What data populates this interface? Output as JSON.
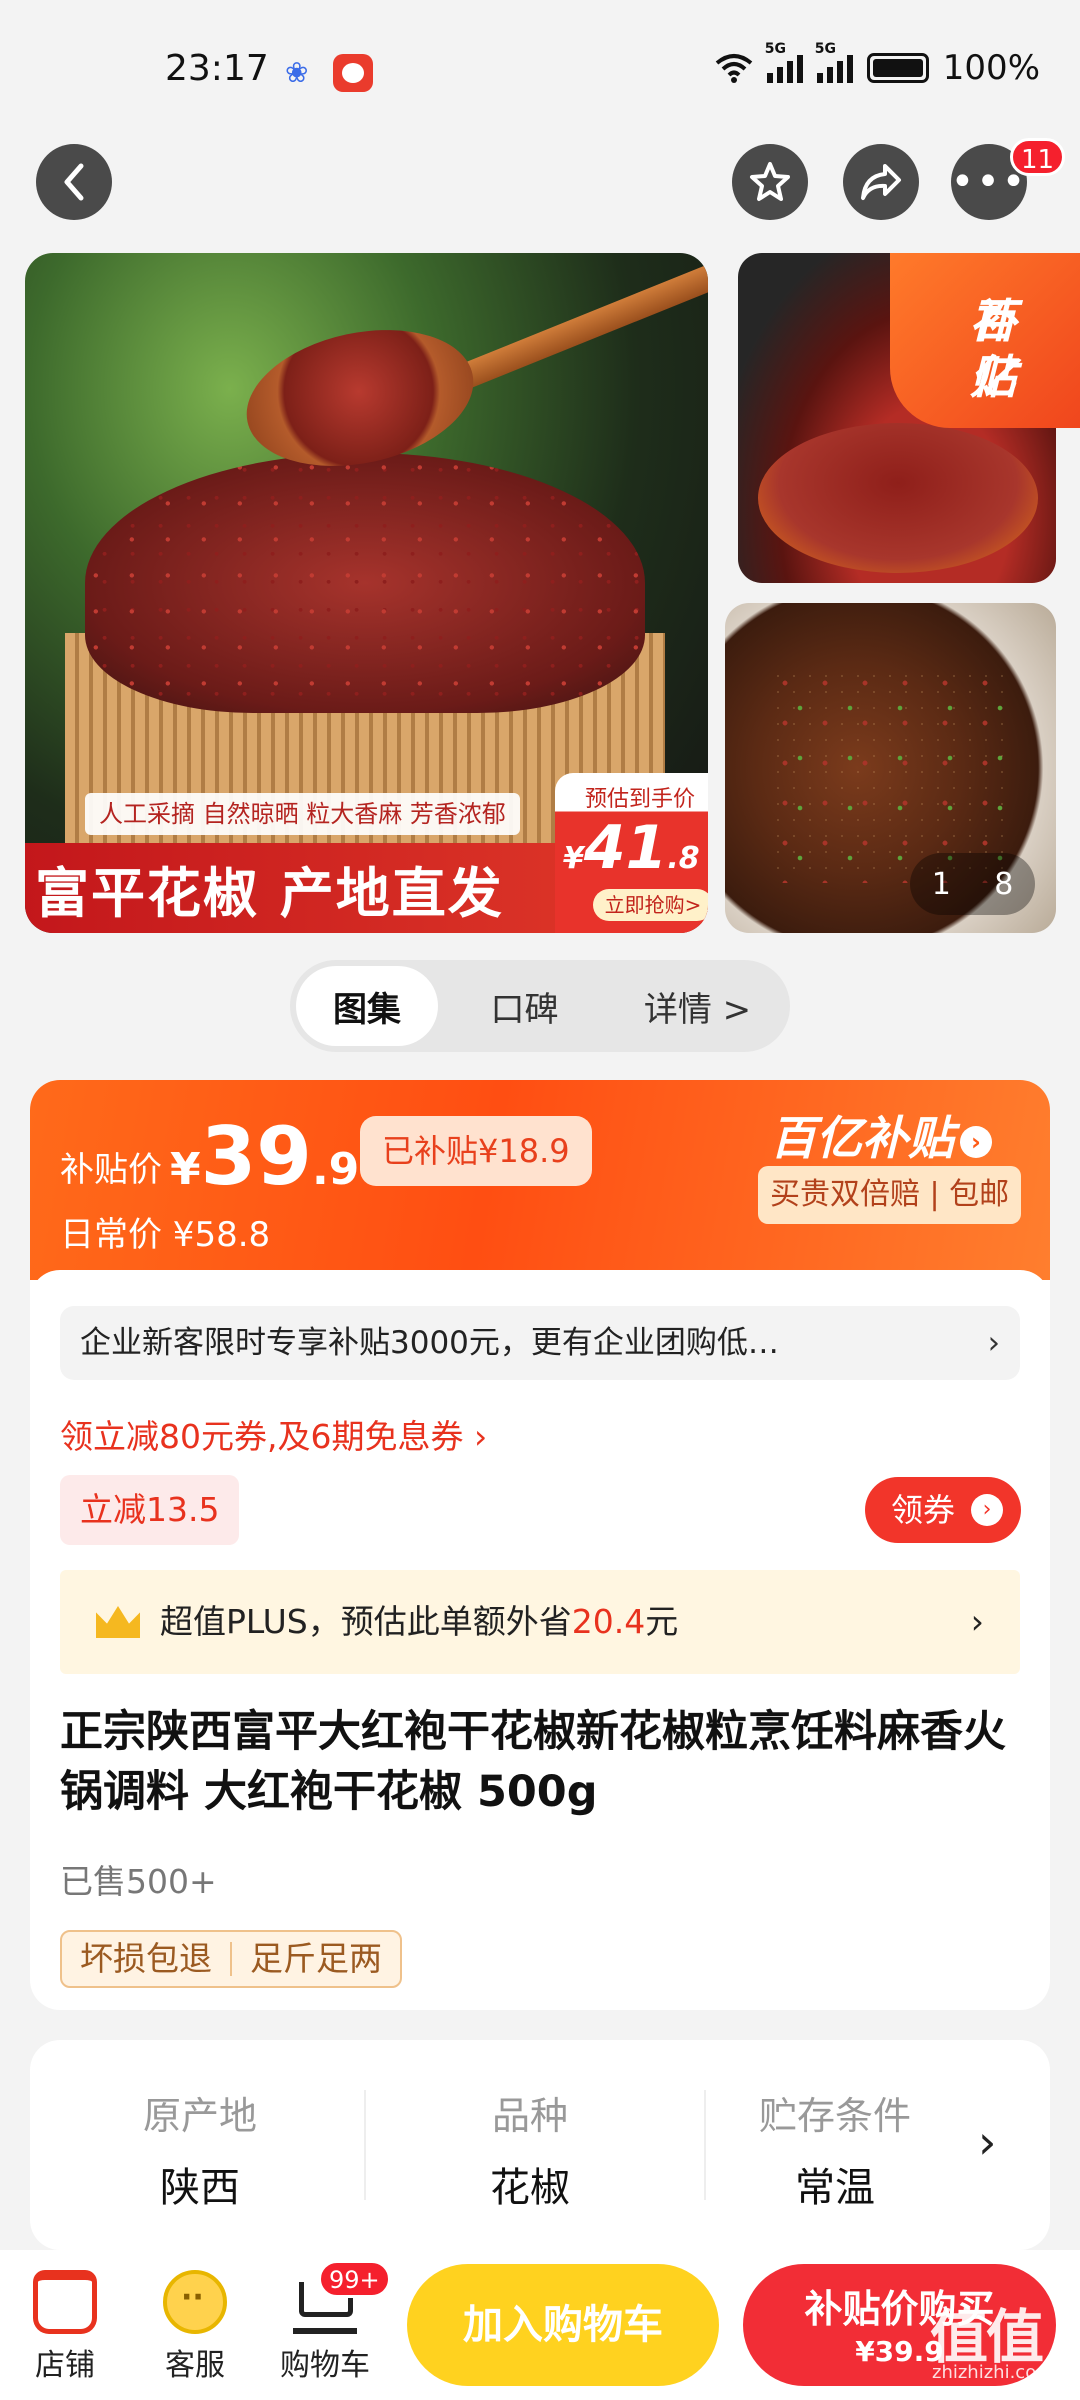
{
  "status_bar": {
    "time": "23:17",
    "battery": "100%",
    "signal1": "5G",
    "signal2": "5G"
  },
  "header": {
    "more_badge": "11"
  },
  "gallery": {
    "main_tagline": "人工采摘 自然晾晒 粒大香麻 芳香浓郁",
    "main_title": "富平花椒 产地直发",
    "sticker_label": "预估到手价",
    "sticker_currency": "¥",
    "sticker_price_int": "41",
    "sticker_price_dec": ".8",
    "sticker_button": "立即抢购>",
    "subsidy_badge_line1": "百亿",
    "subsidy_badge_line2": "补贴",
    "counter_current": "1",
    "counter_total": "8"
  },
  "segment": {
    "tabs": [
      "图集",
      "口碑",
      "详情 >"
    ],
    "active": "图集"
  },
  "price": {
    "label": "补贴价",
    "currency": "¥",
    "int": "39",
    "dec": ".9",
    "subsidized": "已补贴¥18.9",
    "daily_price": "日常价 ¥58.8",
    "brand": "百亿补贴",
    "guarantee": "买贵双倍赔 | 包邮"
  },
  "promo": {
    "enterprise": "企业新客限时专享补贴3000元，更有企业团购低…",
    "coupon_link": "领立减80元券,及6期免息券 ›",
    "discount_chip": "立减13.5",
    "coupon_button": "领券",
    "plus_prefix": "超值PLUS，预估此单额外省",
    "plus_amount": "20.4",
    "plus_suffix": "元"
  },
  "product": {
    "title": "正宗陕西富平大红袍干花椒新花椒粒烹饪料麻香火锅调料 大红袍干花椒 500g",
    "sold": "已售500+",
    "tags": [
      "坏损包退",
      "足斤足两"
    ]
  },
  "specs": [
    {
      "label": "原产地",
      "value": "陕西"
    },
    {
      "label": "品种",
      "value": "花椒"
    },
    {
      "label": "贮存条件",
      "value": "常温"
    }
  ],
  "bottom_bar": {
    "store": "店铺",
    "service": "客服",
    "cart": "购物车",
    "cart_badge": "99+",
    "add_to_cart": "加入购物车",
    "buy_line1": "补贴价购买",
    "buy_line2": "¥39.9"
  },
  "watermark": {
    "main": "值值值",
    "sub": "zhizhizhi.com"
  },
  "colors": {
    "accent_red": "#f22d36",
    "subsidy_orange": "#ff5a14",
    "cart_yellow": "#ffd21f"
  }
}
